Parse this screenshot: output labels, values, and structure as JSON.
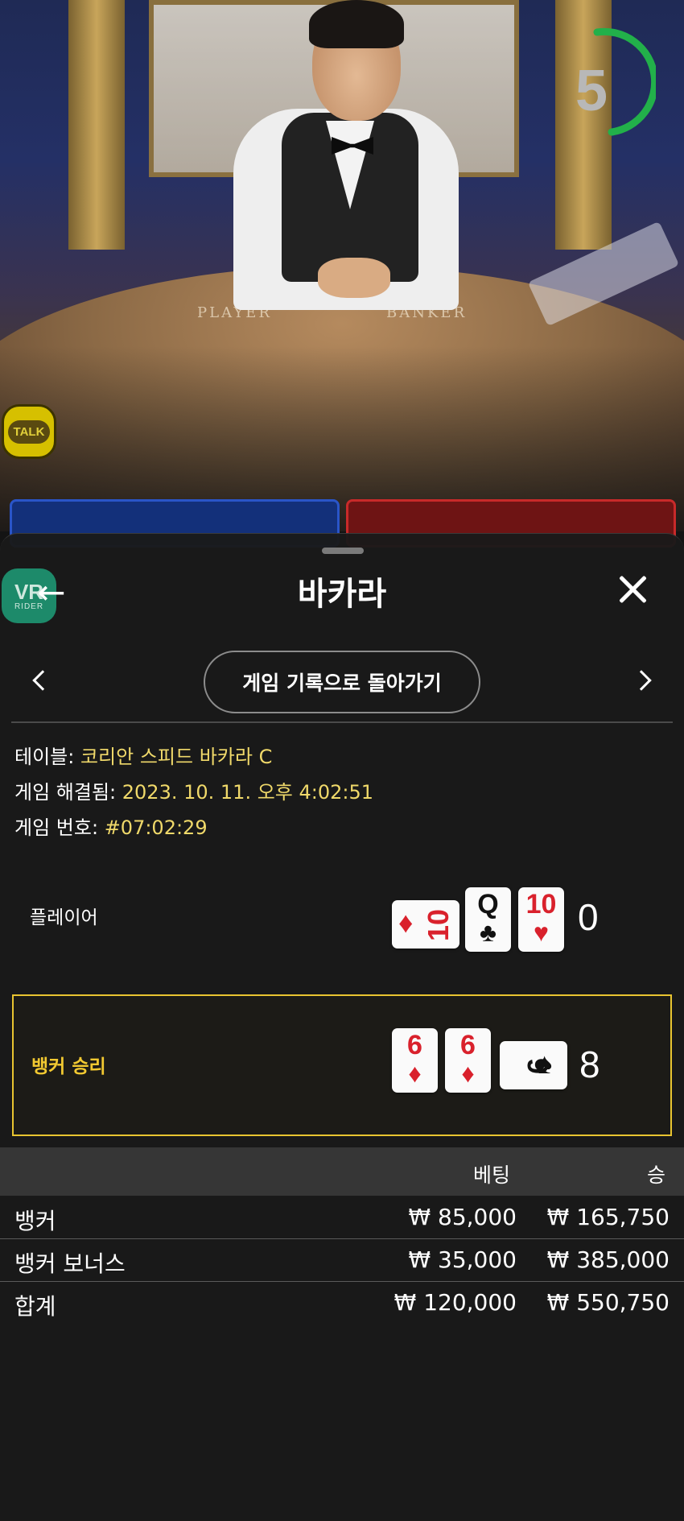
{
  "scene": {
    "felt_player": "PLAYER",
    "felt_banker": "BANKER",
    "countdown": "5",
    "talk_label": "TALK"
  },
  "badge": {
    "logo_text": "VR",
    "logo_sub": "RIDER"
  },
  "header": {
    "title": "바카라",
    "back_icon": "arrow-left-icon",
    "close_icon": "close-icon"
  },
  "nav": {
    "prev_icon": "chevron-left-icon",
    "next_icon": "chevron-right-icon",
    "back_to_history": "게임 기록으로 돌아가기"
  },
  "info": {
    "table_label": "테이블:",
    "table_value": "코리안 스피드 바카라 C",
    "resolved_label": "게임 해결됨:",
    "resolved_value": "2023. 10. 11. 오후 4:02:51",
    "number_label": "게임 번호:",
    "number_value": "#07:02:29"
  },
  "hands": {
    "player": {
      "label": "플레이어",
      "score": "0",
      "cards": [
        {
          "rank": "10",
          "suit": "♦",
          "color": "#d9212c",
          "orientation": "horizontal"
        },
        {
          "rank": "Q",
          "suit": "♣",
          "color": "#111111",
          "orientation": "vertical"
        },
        {
          "rank": "10",
          "suit": "♥",
          "color": "#d9212c",
          "orientation": "vertical"
        }
      ]
    },
    "banker": {
      "label": "뱅커 승리",
      "score": "8",
      "highlight_color": "#e8c430",
      "cards": [
        {
          "rank": "6",
          "suit": "♦",
          "color": "#d9212c",
          "orientation": "vertical"
        },
        {
          "rank": "6",
          "suit": "♦",
          "color": "#d9212c",
          "orientation": "vertical"
        },
        {
          "rank": "6",
          "suit": "♠",
          "color": "#111111",
          "orientation": "horizontal"
        }
      ]
    }
  },
  "bets": {
    "headers": {
      "bet": "베팅",
      "win": "승"
    },
    "rows": [
      {
        "name": "뱅커",
        "bet": "₩ 85,000",
        "win": "₩ 165,750"
      },
      {
        "name": "뱅커 보너스",
        "bet": "₩ 35,000",
        "win": "₩ 385,000"
      }
    ],
    "total": {
      "name": "합계",
      "bet": "₩ 120,000",
      "win": "₩ 550,750"
    }
  },
  "colors": {
    "accent_gold": "#f0d96a",
    "winner_yellow": "#f2c931",
    "timer_green": "#22b04a",
    "sheet_bg": "#1a1a1a"
  }
}
